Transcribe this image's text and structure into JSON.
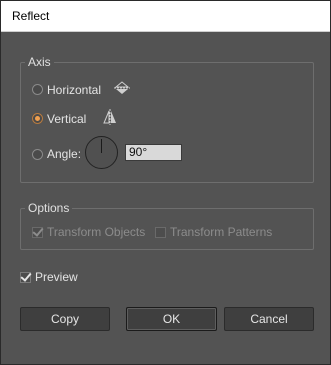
{
  "window": {
    "title": "Reflect"
  },
  "axis": {
    "label": "Axis",
    "options": [
      {
        "label": "Horizontal",
        "selected": false,
        "icon": "reflect-horizontal-icon"
      },
      {
        "label": "Vertical",
        "selected": true,
        "icon": "reflect-vertical-icon"
      },
      {
        "label": "Angle:",
        "selected": false,
        "icon": "angle-dial-icon"
      }
    ],
    "angle_value": "90°"
  },
  "options": {
    "label": "Options",
    "transform_objects": {
      "label": "Transform Objects",
      "checked": true,
      "enabled": false
    },
    "transform_patterns": {
      "label": "Transform Patterns",
      "checked": false,
      "enabled": false
    }
  },
  "preview": {
    "label": "Preview",
    "checked": true
  },
  "buttons": {
    "copy": "Copy",
    "ok": "OK",
    "cancel": "Cancel"
  },
  "colors": {
    "dialog_bg": "#535353",
    "accent": "#f0a050",
    "input_bg": "#d9d9d9"
  }
}
